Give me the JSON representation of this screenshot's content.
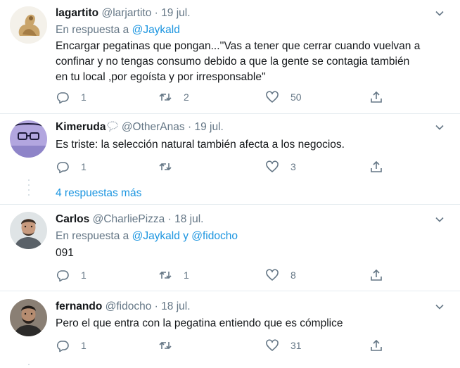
{
  "tweets": [
    {
      "name": "lagartito",
      "handle": "@larjartito",
      "date": "19 jul.",
      "reply_prefix": "En respuesta a",
      "reply_to": "@Jaykald",
      "lines": [
        "Encargar pegatinas que pongan...''Vas a tener que cerrar cuando vuelvan a",
        "confinar y no tengas consumo debido a que la gente se contagia también",
        "en tu local ,por egoísta y por irresponsable''"
      ],
      "replies": "1",
      "retweets": "2",
      "likes": "50"
    },
    {
      "name": "Kimeruda",
      "name_icon": "speech-bubble-icon",
      "handle": "@OtherAnas",
      "date": "19 jul.",
      "lines": [
        "Es triste: la selección natural también afecta a los negocios."
      ],
      "replies": "1",
      "retweets": "",
      "likes": "3"
    },
    {
      "name": "Carlos",
      "handle": "@CharliePizza",
      "date": "18 jul.",
      "reply_prefix": "En respuesta a",
      "reply_to": "@Jaykald",
      "reply_joiner": "y",
      "reply_to_2": "@fidocho",
      "lines": [
        "091"
      ],
      "replies": "1",
      "retweets": "1",
      "likes": "8"
    },
    {
      "name": "fernando",
      "handle": "@fidocho",
      "date": "18 jul.",
      "lines": [
        "Pero el que entra con la pegatina entiendo que es cómplice"
      ],
      "replies": "1",
      "retweets": "",
      "likes": "31"
    }
  ],
  "show_more": "4 respuestas más",
  "separator": "·",
  "colors": {
    "accent": "#1b95e0",
    "muted": "#657786",
    "text": "#14171a",
    "divider": "#e6ecf0"
  },
  "icons": {
    "reply": "reply-icon",
    "retweet": "retweet-icon",
    "like": "heart-icon",
    "share": "share-icon",
    "caret": "chevron-down-icon"
  }
}
